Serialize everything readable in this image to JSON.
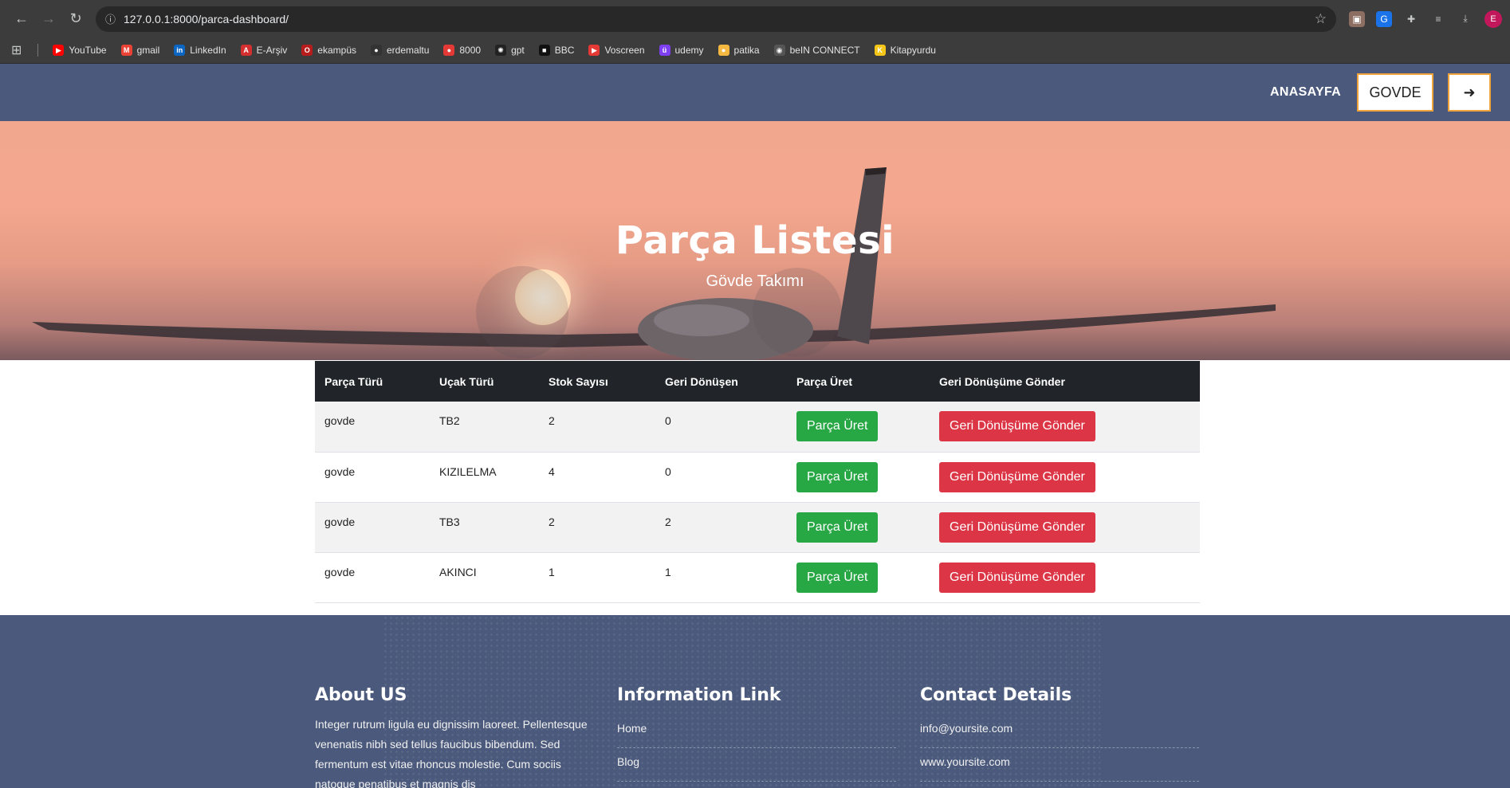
{
  "browser": {
    "url": "127.0.0.1:8000/parca-dashboard/",
    "profile_initial": "E",
    "bookmarks": [
      {
        "label": "YouTube",
        "color": "#ff0000",
        "glyph": "▶"
      },
      {
        "label": "gmail",
        "color": "#ea4335",
        "glyph": "M"
      },
      {
        "label": "LinkedIn",
        "color": "#0a66c2",
        "glyph": "in"
      },
      {
        "label": "E-Arşiv",
        "color": "#d32f2f",
        "glyph": "A"
      },
      {
        "label": "ekampüs",
        "color": "#b71c1c",
        "glyph": "O"
      },
      {
        "label": "erdemaltu",
        "color": "#333333",
        "glyph": "●"
      },
      {
        "label": "8000",
        "color": "#e53935",
        "glyph": "●"
      },
      {
        "label": "gpt",
        "color": "#222222",
        "glyph": "✺"
      },
      {
        "label": "BBC",
        "color": "#111111",
        "glyph": "■"
      },
      {
        "label": "Voscreen",
        "color": "#e53935",
        "glyph": "▶"
      },
      {
        "label": "udemy",
        "color": "#7e3ff2",
        "glyph": "ü"
      },
      {
        "label": "patika",
        "color": "#f5b942",
        "glyph": "●"
      },
      {
        "label": "beIN CONNECT",
        "color": "#555555",
        "glyph": "◉"
      },
      {
        "label": "Kitapyurdu",
        "color": "#f5c518",
        "glyph": "K"
      }
    ]
  },
  "header": {
    "home": "ANASAYFA",
    "govde": "GOVDE",
    "logout_glyph": "➜"
  },
  "hero": {
    "title": "Parça Listesi",
    "subtitle": "Gövde Takımı"
  },
  "table": {
    "columns": [
      "Parça Türü",
      "Uçak Türü",
      "Stok Sayısı",
      "Geri Dönüşen",
      "Parça Üret",
      "Geri Dönüşüme Gönder"
    ],
    "rows": [
      {
        "parca": "govde",
        "ucak": "TB2",
        "stok": "2",
        "geri": "0"
      },
      {
        "parca": "govde",
        "ucak": "KIZILELMA",
        "stok": "4",
        "geri": "0"
      },
      {
        "parca": "govde",
        "ucak": "TB3",
        "stok": "2",
        "geri": "2"
      },
      {
        "parca": "govde",
        "ucak": "AKINCI",
        "stok": "1",
        "geri": "1"
      }
    ],
    "produce_label": "Parça Üret",
    "recycle_label": "Geri Dönüşüme Gönder"
  },
  "footer": {
    "about_title": "About US",
    "about_text": "Integer rutrum ligula eu dignissim laoreet. Pellentesque venenatis nibh sed tellus faucibus bibendum. Sed fermentum est vitae rhoncus molestie. Cum sociis natoque penatibus et magnis dis",
    "info_title": "Information Link",
    "info_links": [
      "Home",
      "Blog"
    ],
    "contact_title": "Contact Details",
    "contact_items": [
      "info@yoursite.com",
      "www.yoursite.com"
    ]
  }
}
